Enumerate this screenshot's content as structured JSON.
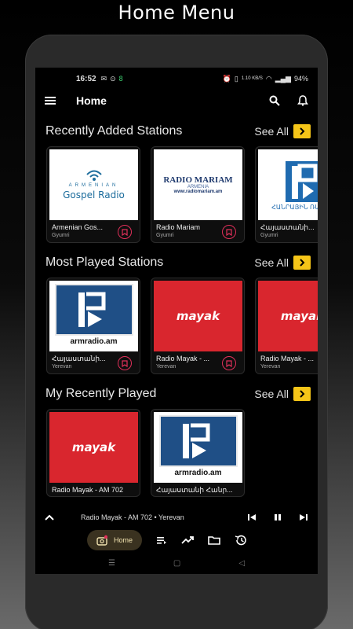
{
  "promo_title": "Home Menu",
  "status": {
    "time": "16:52",
    "sim_badge": "8",
    "net_speed": "1.10 KB/S",
    "battery": "94%"
  },
  "app_bar": {
    "title": "Home"
  },
  "sections": [
    {
      "title": "Recently Added Stations",
      "see_all": "See All",
      "cards": [
        {
          "name": "Armenian Gos...",
          "location": "Gyumri",
          "art": "gospel",
          "art_small": "ARMENIAN",
          "art_label": "Gospel Radio"
        },
        {
          "name": "Radio Mariam",
          "location": "Gyumri",
          "art": "mariam",
          "art_label": "RADIO MARIAM",
          "art_sub": "ARMENIA",
          "art_url": "www.radiomariam.am"
        },
        {
          "name": "Հայաստանի...",
          "location": "Gyumri",
          "art": "hanrayin",
          "art_label": "ՀԱՆՐԱՅԻՆ ՌԱԴԻՈ"
        }
      ]
    },
    {
      "title": "Most Played Stations",
      "see_all": "See All",
      "cards": [
        {
          "name": "Հայաստանի...",
          "location": "Yerevan",
          "art": "armradio",
          "art_label": "armradio.am"
        },
        {
          "name": "Radio Mayak - ...",
          "location": "Yerevan",
          "art": "mayak",
          "art_label": "mayak"
        },
        {
          "name": "Radio Mayak - ...",
          "location": "Yerevan",
          "art": "mayak",
          "art_label": "mayak"
        }
      ]
    },
    {
      "title": "My Recently Played",
      "see_all": "See All",
      "cards": [
        {
          "name": "Radio Mayak - AM 702",
          "location": "",
          "art": "mayak",
          "art_label": "mayak"
        },
        {
          "name": "Հայաստանի Հանր...",
          "location": "",
          "art": "armradio",
          "art_label": "armradio.am"
        }
      ]
    }
  ],
  "mini_player": {
    "now_playing": "Radio Mayak - AM 702 • Yerevan"
  },
  "bottom_nav": {
    "home_label": "Home"
  },
  "colors": {
    "accent": "#f5c518",
    "bookmark": "#e0305a",
    "mayak_red": "#d9262e",
    "armradio_blue": "#1f4f86"
  }
}
